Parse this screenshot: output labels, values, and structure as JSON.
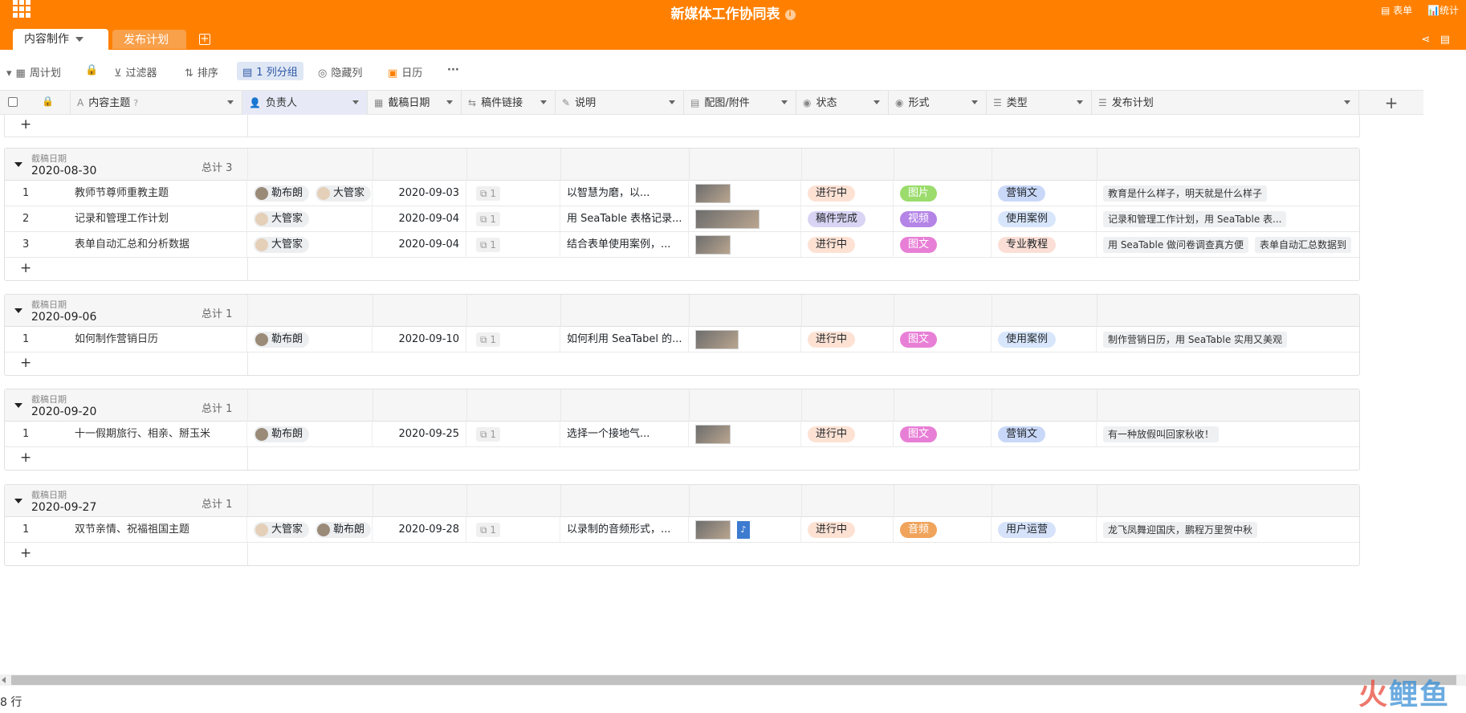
{
  "header": {
    "title": "新媒体工作协同表",
    "form_btn": "表单",
    "stats_btn": "统计"
  },
  "tabs": [
    {
      "label": "内容制作"
    },
    {
      "label": "发布计划"
    }
  ],
  "toolbar": {
    "view": "周计划",
    "filter": "过滤器",
    "sort": "排序",
    "group": "1 列分组",
    "hide": "隐藏列",
    "calendar": "日历",
    "more": "···"
  },
  "columns": [
    {
      "label": "内容主题",
      "icon": "A"
    },
    {
      "label": "负责人",
      "icon": "👤"
    },
    {
      "label": "截稿日期",
      "icon": "▦"
    },
    {
      "label": "稿件链接",
      "icon": "⇆"
    },
    {
      "label": "说明",
      "icon": "✎"
    },
    {
      "label": "配图/附件",
      "icon": "▤"
    },
    {
      "label": "状态",
      "icon": "◉"
    },
    {
      "label": "形式",
      "icon": "◉"
    },
    {
      "label": "类型",
      "icon": "☰"
    },
    {
      "label": "发布计划",
      "icon": "☰"
    }
  ],
  "group_field": "截稿日期",
  "groups": [
    {
      "date": "2020-08-30",
      "count": "总计 3",
      "rows": [
        {
          "n": "1",
          "topic": "教师节尊师重教主题",
          "people": [
            "勒布朗",
            "大管家"
          ],
          "date": "2020-09-03",
          "link": "1",
          "note": "以智慧为磨，以...",
          "status": "进行中",
          "form": "图片",
          "type": "营销文",
          "plans": [
            "教育是什么样子，明天就是什么样子"
          ]
        },
        {
          "n": "2",
          "topic": "记录和管理工作计划",
          "people": [
            "大管家"
          ],
          "date": "2020-09-04",
          "link": "1",
          "note": "用 SeaTable 表格记录...",
          "status": "稿件完成",
          "form": "视频",
          "type": "使用案例",
          "plans": [
            "记录和管理工作计划，用 SeaTable 表..."
          ]
        },
        {
          "n": "3",
          "topic": "表单自动汇总和分析数据",
          "people": [
            "大管家"
          ],
          "date": "2020-09-04",
          "link": "1",
          "note": "结合表单使用案例，...",
          "status": "进行中",
          "form": "图文",
          "type": "专业教程",
          "plans": [
            "用 SeaTable 做问卷调查真方便",
            "表单自动汇总数据到"
          ]
        }
      ]
    },
    {
      "date": "2020-09-06",
      "count": "总计 1",
      "rows": [
        {
          "n": "1",
          "topic": "如何制作营销日历",
          "people": [
            "勒布朗"
          ],
          "date": "2020-09-10",
          "link": "1",
          "note": "如何利用 SeaTabel 的...",
          "status": "进行中",
          "form": "图文",
          "type": "使用案例",
          "plans": [
            "制作营销日历，用 SeaTable 实用又美观"
          ]
        }
      ]
    },
    {
      "date": "2020-09-20",
      "count": "总计 1",
      "rows": [
        {
          "n": "1",
          "topic": "十一假期旅行、相亲、掰玉米",
          "people": [
            "勒布朗"
          ],
          "date": "2020-09-25",
          "link": "1",
          "note": "选择一个接地气...",
          "status": "进行中",
          "form": "图文",
          "type": "营销文",
          "plans": [
            "有一种放假叫回家秋收！"
          ]
        }
      ]
    },
    {
      "date": "2020-09-27",
      "count": "总计 1",
      "rows": [
        {
          "n": "1",
          "topic": "双节亲情、祝福祖国主题",
          "people": [
            "大管家",
            "勒布朗"
          ],
          "date": "2020-09-28",
          "link": "1",
          "note": "以录制的音频形式，...",
          "status": "进行中",
          "form": "音频",
          "type": "用户运营",
          "plans": [
            "龙飞凤舞迎国庆，鹏程万里贺中秋"
          ]
        }
      ]
    }
  ],
  "footer": {
    "row_count": "8 行",
    "watermark_a": "火",
    "watermark_b": "鲤鱼"
  },
  "colors": {
    "brand": "#ff8000",
    "status": {
      "进行中": "#fde2d4",
      "稿件完成": "#d9d4f3"
    },
    "form": {
      "图片": "#9bdc6c",
      "视频": "#b484e6",
      "图文": "#e87fd6",
      "音频": "#f0a35a"
    },
    "type": {
      "营销文": "#c9d8f8",
      "使用案例": "#d8e6fb",
      "专业教程": "#fbdfd6",
      "用户运营": "#d6e2fa"
    }
  }
}
